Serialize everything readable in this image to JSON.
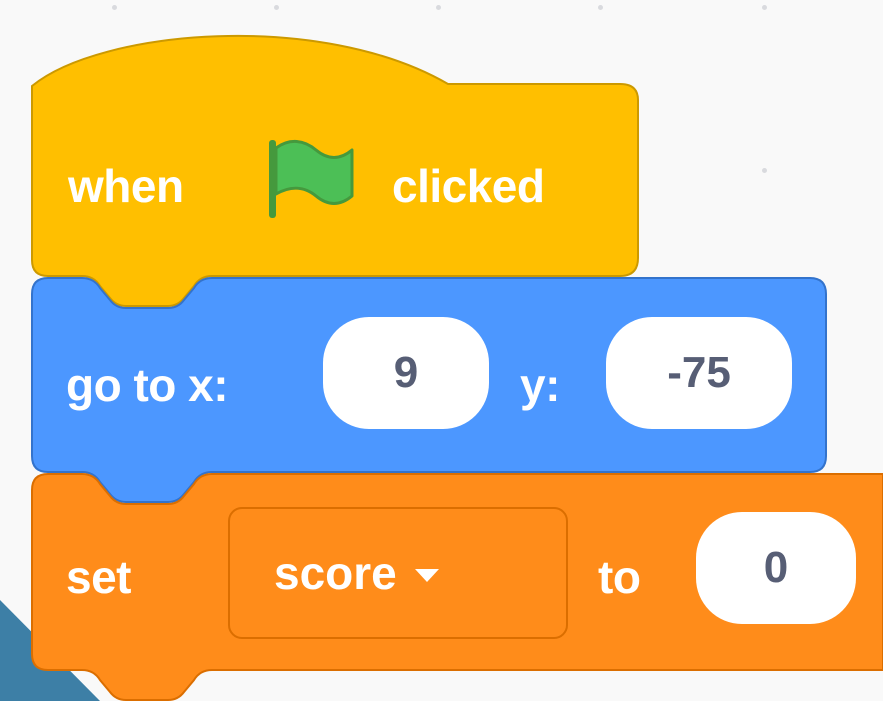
{
  "script": {
    "hat_block": {
      "prefix": "when",
      "icon": "green-flag-icon",
      "suffix": "clicked",
      "color": "#ffbf00"
    },
    "motion_block": {
      "label_x": "go to x:",
      "x_value": "9",
      "label_y": "y:",
      "y_value": "-75",
      "color": "#4c97ff"
    },
    "variable_block": {
      "label_set": "set",
      "variable": "score",
      "label_to": "to",
      "value": "0",
      "color": "#ff8c1a"
    }
  },
  "theme": {
    "workspace_background": "#f9f9f9",
    "outer_background": "#3d7fa6",
    "flag_color": "#4cbf56"
  }
}
